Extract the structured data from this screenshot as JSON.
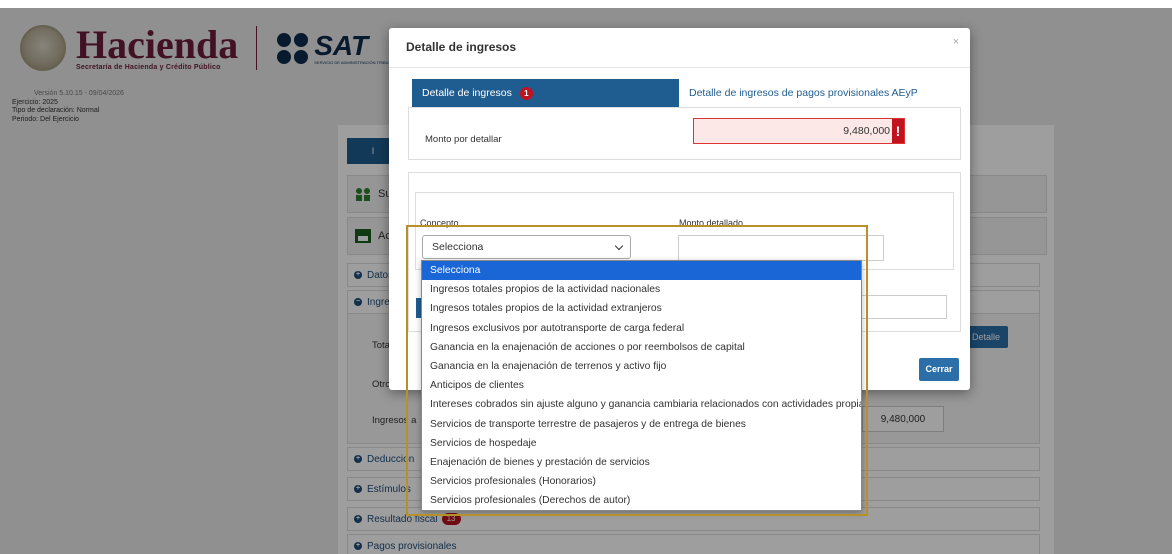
{
  "header": {
    "brand_hacienda": "Hacienda",
    "brand_hacienda_sub": "Secretaría de Hacienda y Crédito Público",
    "brand_sat": "SAT",
    "brand_sat_sub": "SERVICIO DE ADMINISTRACIÓN TRIBUTARIA",
    "version": "Versión 5.10.15 - 09/04/2026",
    "ejercicio": "Ejercicio: 2025",
    "tipo": "Tipo de declaración: Normal",
    "periodo": "Periodo: Del Ejercicio"
  },
  "background": {
    "tab_label": "I",
    "sections": [
      "Sue",
      "Acti"
    ],
    "rows": {
      "datos": "Datos",
      "ingresos": "Ingres",
      "deducciones": "Deduccion",
      "estimulos": "Estímulos",
      "resultado": "Resultado fiscal",
      "resultado_badge": "13",
      "pagos": "Pagos provisionales"
    },
    "labels": {
      "total": "Total",
      "otros": "Otros",
      "ingresos_a": "Ingresos a"
    },
    "detalle_button": "Detalle",
    "ingresos_amount": "9,480,000"
  },
  "modal": {
    "title": "Detalle de ingresos",
    "close": "×",
    "tab_active": "Detalle de ingresos",
    "tab_active_badge": "1",
    "tab_inactive": "Detalle de ingresos de pagos provisionales AEyP",
    "monto_label": "Monto por detallar",
    "monto_value": "9,480,000",
    "monto_alert": "!",
    "concepto_label": "Concepto",
    "monto_detallado_label": "Monto detallado",
    "select_value": "Selecciona",
    "cerrar_button": "Cerrar"
  },
  "dropdown": {
    "options": [
      "Selecciona",
      "Ingresos totales propios de la actividad nacionales",
      "Ingresos totales propios de la actividad extranjeros",
      "Ingresos exclusivos por autotransporte de carga federal",
      "Ganancia en la enajenación de acciones o por reembolsos de capital",
      "Ganancia en la enajenación de terrenos y activo fijo",
      "Anticipos de clientes",
      "Intereses cobrados sin ajuste alguno y ganancia cambiaria relacionados con actividades propias",
      "Servicios de transporte terrestre de pasajeros y de entrega de bienes",
      "Servicios de hospedaje",
      "Enajenación de bienes y prestación de servicios",
      "Servicios profesionales (Honorarios)",
      "Servicios profesionales (Derechos de autor)"
    ],
    "selected_index": 0
  },
  "colors": {
    "primary": "#1f5c8f",
    "alert": "#c0131f",
    "selected_option": "#1a66d6",
    "highlight": "#b8902a"
  }
}
